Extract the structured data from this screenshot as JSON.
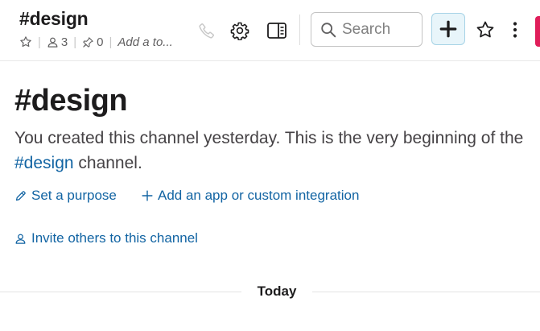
{
  "header": {
    "channel_name": "#design",
    "member_count": "3",
    "pinned_count": "0",
    "topic_placeholder": "Add a to...",
    "search_placeholder": "Search"
  },
  "intro": {
    "title": "#design",
    "text_before": "You created this channel yesterday. This is the very beginning of the ",
    "channel_link": "#design",
    "text_after": " channel."
  },
  "actions": {
    "set_purpose": "Set a purpose",
    "add_app": "Add an app or custom integration",
    "invite": "Invite others to this channel"
  },
  "divider": {
    "label": "Today"
  },
  "colors": {
    "link": "#1264a3",
    "accent_red": "#e01e5a",
    "plus_bg": "#e8f5fa"
  },
  "icons": [
    "star-outline-icon",
    "person-icon",
    "pin-icon",
    "phone-icon",
    "gear-icon",
    "details-panel-icon",
    "search-icon",
    "plus-icon",
    "star-icon",
    "more-vertical-icon",
    "pencil-icon",
    "plus-small-icon",
    "person-icon"
  ]
}
